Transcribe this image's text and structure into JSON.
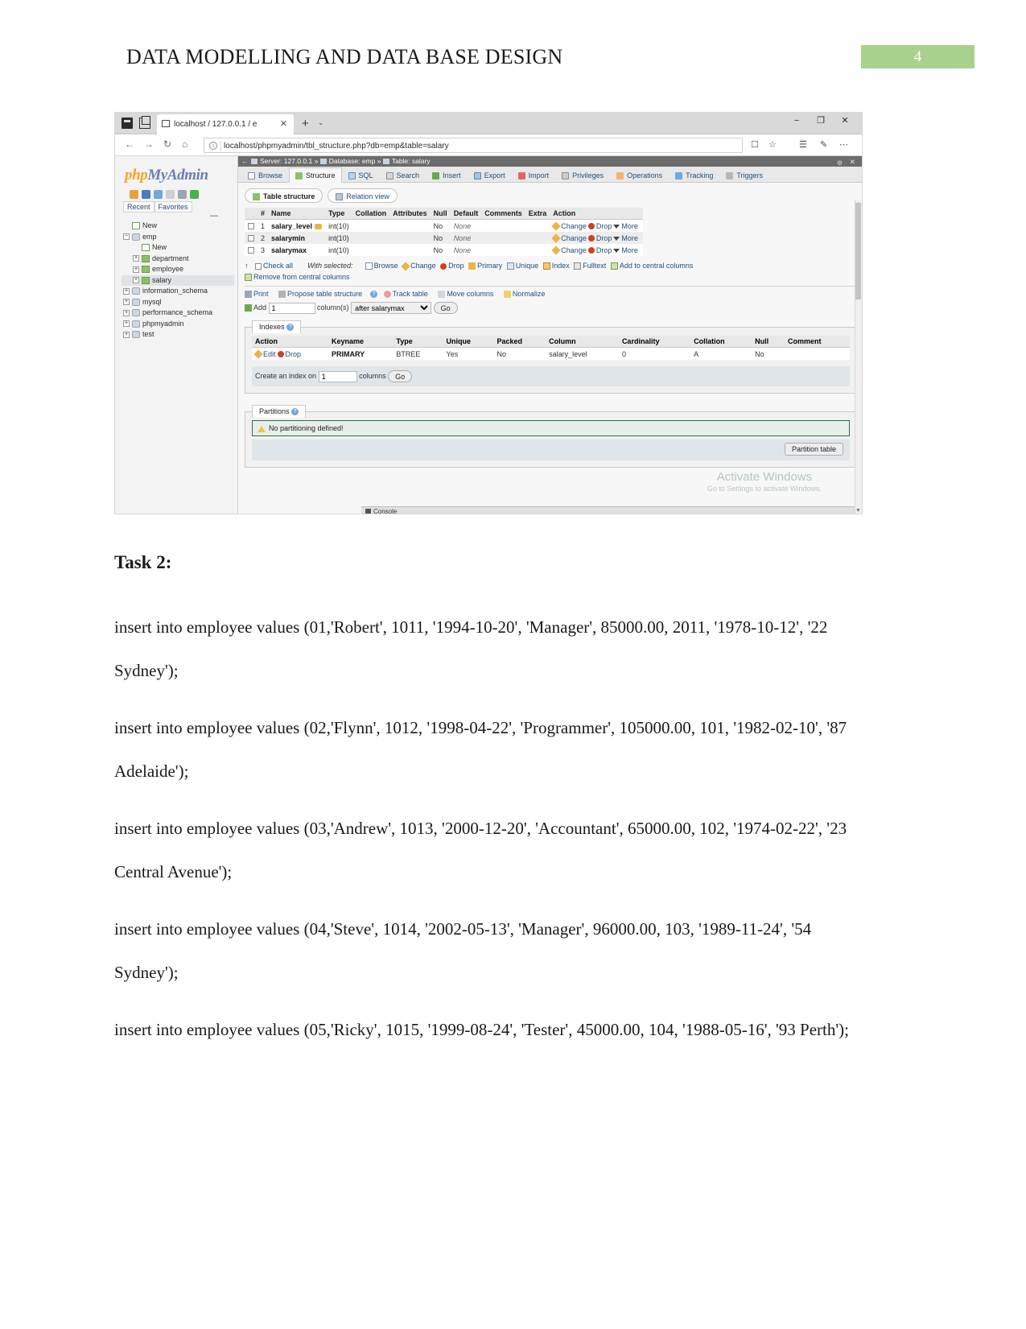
{
  "header": {
    "doc_title": "DATA MODELLING AND DATA BASE DESIGN",
    "page_number": "4",
    "accent_color": "#a9d18e"
  },
  "browser": {
    "tab_title": "localhost / 127.0.0.1 / e",
    "tab_close": "✕",
    "new_tab": "+",
    "tab_menu": "⌄",
    "window_minimize": "−",
    "window_maximize": "❐",
    "window_close": "✕",
    "nav_back": "←",
    "nav_forward": "→",
    "nav_refresh": "↻",
    "nav_home": "⌂",
    "url": "localhost/phpmyadmin/tbl_structure.php?db=emp&table=salary",
    "info_icon": "i",
    "reading_view_icon": "☐",
    "favorite_icon": "☆",
    "favorites_bar_icon": "☰",
    "notes_icon": "✎",
    "more_icon": "⋯"
  },
  "pma": {
    "logo_part1": "php",
    "logo_part2": "MyAdmin",
    "quick_links": [
      "Recent",
      "Favorites"
    ],
    "tree": [
      {
        "label": "New",
        "indent": 0,
        "icon": "new-icon",
        "expander": "",
        "selected": false
      },
      {
        "label": "emp",
        "indent": 0,
        "icon": "db-icon",
        "expander": "-",
        "selected": false
      },
      {
        "label": "New",
        "indent": 1,
        "icon": "new-icon",
        "expander": "",
        "selected": false
      },
      {
        "label": "department",
        "indent": 1,
        "icon": "table-icon",
        "expander": "+",
        "selected": false
      },
      {
        "label": "employee",
        "indent": 1,
        "icon": "table-icon",
        "expander": "+",
        "selected": false
      },
      {
        "label": "salary",
        "indent": 1,
        "icon": "table-icon",
        "expander": "+",
        "selected": true
      },
      {
        "label": "information_schema",
        "indent": 0,
        "icon": "db-icon",
        "expander": "+",
        "selected": false
      },
      {
        "label": "mysql",
        "indent": 0,
        "icon": "db-icon",
        "expander": "+",
        "selected": false
      },
      {
        "label": "performance_schema",
        "indent": 0,
        "icon": "db-icon",
        "expander": "+",
        "selected": false
      },
      {
        "label": "phpmyadmin",
        "indent": 0,
        "icon": "db-icon",
        "expander": "+",
        "selected": false
      },
      {
        "label": "test",
        "indent": 0,
        "icon": "db-icon",
        "expander": "+",
        "selected": false
      }
    ],
    "breadcrumb": {
      "back": "←",
      "server_label": "Server: 127.0.0.1",
      "sep1": "»",
      "database_label": "Database: emp",
      "sep2": "»",
      "table_label": "Table: salary",
      "settings_icon": "⚙",
      "close_icon": "✕"
    },
    "tabs": [
      {
        "label": "Browse",
        "icon": "browse-icon",
        "active": false
      },
      {
        "label": "Structure",
        "icon": "structure-icon",
        "active": true
      },
      {
        "label": "SQL",
        "icon": "sql-icon",
        "active": false
      },
      {
        "label": "Search",
        "icon": "search-icon",
        "active": false
      },
      {
        "label": "Insert",
        "icon": "insert-icon",
        "active": false
      },
      {
        "label": "Export",
        "icon": "export-icon",
        "active": false
      },
      {
        "label": "Import",
        "icon": "import-icon",
        "active": false
      },
      {
        "label": "Privileges",
        "icon": "privileges-icon",
        "active": false
      },
      {
        "label": "Operations",
        "icon": "operations-icon",
        "active": false
      },
      {
        "label": "Tracking",
        "icon": "tracking-icon",
        "active": false
      },
      {
        "label": "Triggers",
        "icon": "triggers-icon",
        "active": false
      }
    ],
    "subtabs": [
      {
        "label": "Table structure",
        "icon": "structure-icon",
        "active": true
      },
      {
        "label": "Relation view",
        "icon": "relation-icon",
        "active": false
      }
    ],
    "structure_table": {
      "headers": [
        "#",
        "Name",
        "Type",
        "Collation",
        "Attributes",
        "Null",
        "Default",
        "Comments",
        "Extra",
        "Action"
      ],
      "rows": [
        {
          "num": "1",
          "name": "salary_level",
          "primary": true,
          "type": "int(10)",
          "collation": "",
          "attributes": "",
          "null": "No",
          "default": "None",
          "comments": "",
          "extra": ""
        },
        {
          "num": "2",
          "name": "salarymin",
          "primary": false,
          "type": "int(10)",
          "collation": "",
          "attributes": "",
          "null": "No",
          "default": "None",
          "comments": "",
          "extra": ""
        },
        {
          "num": "3",
          "name": "salarymax",
          "primary": false,
          "type": "int(10)",
          "collation": "",
          "attributes": "",
          "null": "No",
          "default": "None",
          "comments": "",
          "extra": ""
        }
      ],
      "row_actions": [
        "Change",
        "Drop",
        "More"
      ]
    },
    "with_selected": {
      "check_all": "Check all",
      "label": "With selected:",
      "actions": [
        "Browse",
        "Change",
        "Drop",
        "Primary",
        "Unique",
        "Index",
        "Fulltext",
        "Add to central columns"
      ],
      "remove_central": "Remove from central columns"
    },
    "tools": [
      "Print",
      "Propose table structure",
      "Track table",
      "Move columns",
      "Normalize"
    ],
    "add_row": {
      "add_label": "Add",
      "count": "1",
      "columns_label": "column(s)",
      "position": "after salarymax",
      "go": "Go"
    },
    "indexes": {
      "legend": "Indexes",
      "headers": [
        "Action",
        "Keyname",
        "Type",
        "Unique",
        "Packed",
        "Column",
        "Cardinality",
        "Collation",
        "Null",
        "Comment"
      ],
      "rows": [
        {
          "edit": "Edit",
          "drop": "Drop",
          "keyname": "PRIMARY",
          "type": "BTREE",
          "unique": "Yes",
          "packed": "No",
          "column": "salary_level",
          "cardinality": "0",
          "collation": "A",
          "null": "No",
          "comment": ""
        }
      ],
      "create_label": "Create an index on",
      "create_count": "1",
      "create_columns_label": "columns",
      "create_go": "Go"
    },
    "partitions": {
      "legend": "Partitions",
      "message": "No partitioning defined!",
      "button": "Partition table"
    },
    "console": "Console",
    "watermark_line1": "Activate Windows",
    "watermark_line2": "Go to Settings to activate Windows."
  },
  "task": {
    "title": "Task 2:",
    "statements": [
      "insert into employee values (01,'Robert', 1011, '1994-10-20', 'Manager', 85000.00, 2011, '1978-10-12', '22 Sydney');",
      "insert into employee values (02,'Flynn', 1012, '1998-04-22', 'Programmer', 105000.00, 101, '1982-02-10', '87 Adelaide');",
      "insert into employee values (03,'Andrew', 1013, '2000-12-20', 'Accountant', 65000.00, 102, '1974-02-22', '23 Central Avenue');",
      "insert into employee values (04,'Steve', 1014, '2002-05-13', 'Manager', 96000.00, 103, '1989-11-24', '54 Sydney');",
      "insert into employee values (05,'Ricky', 1015, '1999-08-24', 'Tester', 45000.00, 104, '1988-05-16', '93 Perth');"
    ]
  }
}
